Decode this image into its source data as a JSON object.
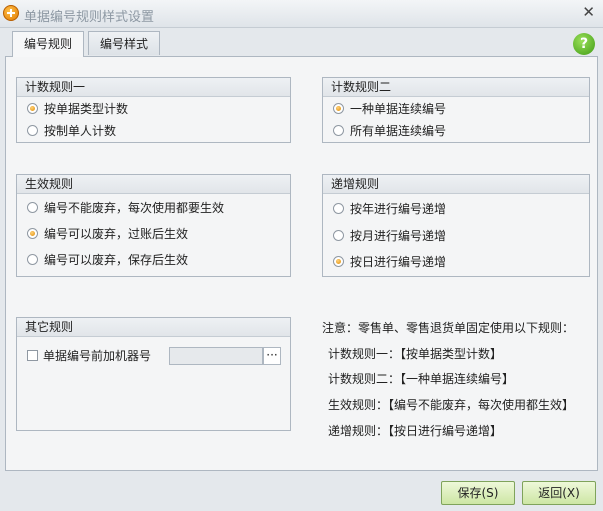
{
  "window": {
    "title": "单据编号规则样式设置",
    "close_label": "✕"
  },
  "tabs": [
    {
      "label": "编号规则",
      "active": true
    },
    {
      "label": "编号样式",
      "active": false
    }
  ],
  "help_label": "?",
  "groups": {
    "count_rule_1": {
      "title": "计数规则一",
      "options": [
        {
          "label": "按单据类型计数",
          "checked": true
        },
        {
          "label": "按制单人计数",
          "checked": false
        }
      ]
    },
    "count_rule_2": {
      "title": "计数规则二",
      "options": [
        {
          "label": "一种单据连续编号",
          "checked": true
        },
        {
          "label": "所有单据连续编号",
          "checked": false
        }
      ]
    },
    "effect_rule": {
      "title": "生效规则",
      "options": [
        {
          "label": "编号不能废弃，每次使用都要生效",
          "checked": false
        },
        {
          "label": "编号可以废弃，过账后生效",
          "checked": true
        },
        {
          "label": "编号可以废弃，保存后生效",
          "checked": false
        }
      ]
    },
    "increment_rule": {
      "title": "递增规则",
      "options": [
        {
          "label": "按年进行编号递增",
          "checked": false
        },
        {
          "label": "按月进行编号递增",
          "checked": false
        },
        {
          "label": "按日进行编号递增",
          "checked": true
        }
      ]
    },
    "other_rule": {
      "title": "其它规则",
      "checkbox_label": "单据编号前加机器号",
      "checked": false,
      "machine_value": "",
      "browse_label": "···"
    }
  },
  "notes": {
    "heading": "注意：零售单、零售退货单固定使用以下规则：",
    "lines": [
      "计数规则一：【按单据类型计数】",
      "计数规则二：【一种单据连续编号】",
      "生效规则：【编号不能废弃，每次使用都生效】",
      "递增规则：【按日进行编号递增】"
    ]
  },
  "buttons": {
    "save": "保存(S)",
    "back": "返回(X)"
  },
  "colors": {
    "accent_orange": "#e08a00",
    "button_green": "#cde6a4",
    "help_green": "#3f9b14"
  }
}
